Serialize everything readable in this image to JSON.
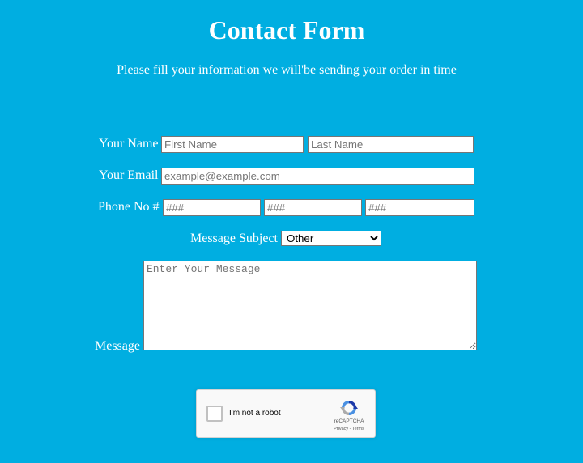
{
  "header": {
    "title": "Contact Form",
    "subtitle": "Please fill your information we will'be sending your order in time"
  },
  "form": {
    "name": {
      "label": "Your Name",
      "first_placeholder": "First Name",
      "last_placeholder": "Last Name"
    },
    "email": {
      "label": "Your Email",
      "placeholder": "example@example.com"
    },
    "phone": {
      "label": "Phone No #",
      "part1_placeholder": "###",
      "part2_placeholder": "###",
      "part3_placeholder": "###"
    },
    "subject": {
      "label": "Message Subject",
      "selected": "Other"
    },
    "message": {
      "label": "Message",
      "placeholder": "Enter Your Message"
    }
  },
  "captcha": {
    "checkbox_label": "I'm not a robot",
    "brand": "reCAPTCHA",
    "privacy": "Privacy",
    "separator": " - ",
    "terms": "Terms",
    "icon": "recaptcha-logo-icon"
  },
  "colors": {
    "background": "#00aee1",
    "text": "#ffffff"
  }
}
